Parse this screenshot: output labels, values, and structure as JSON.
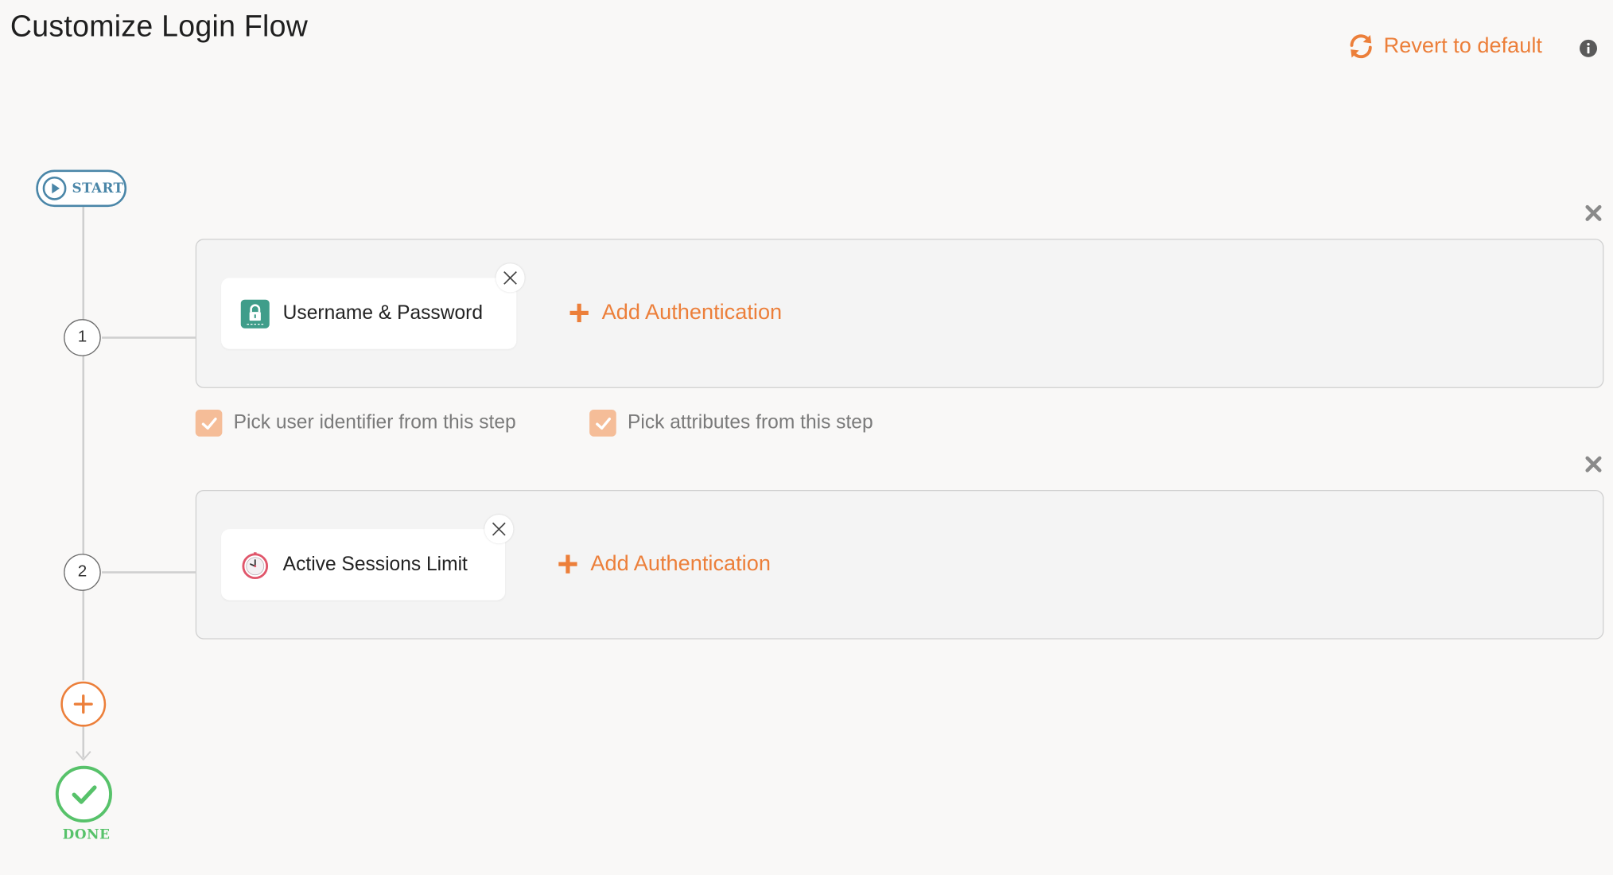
{
  "page": {
    "title": "Customize Login Flow"
  },
  "header": {
    "revert_label": "Revert to default",
    "revert_icon": "refresh-icon",
    "info_icon": "info-icon"
  },
  "flow": {
    "start_label": "START",
    "done_label": "DONE",
    "add_step_icon": "plus-circle-icon",
    "steps": [
      {
        "number": "1",
        "authenticators": [
          {
            "label": "Username & Password",
            "icon": "lock-icon"
          }
        ],
        "add_label": "Add Authentication",
        "options": [
          {
            "label": "Pick user identifier from this step",
            "checked": true
          },
          {
            "label": "Pick attributes from this step",
            "checked": true
          }
        ]
      },
      {
        "number": "2",
        "authenticators": [
          {
            "label": "Active Sessions Limit",
            "icon": "clock-icon"
          }
        ],
        "add_label": "Add Authentication"
      }
    ]
  },
  "colors": {
    "accent": "#ec7f3a",
    "start": "#4a86a8",
    "done": "#57c26a",
    "checkbox": "#f5bd98",
    "lock_bg": "#3f9d8a"
  }
}
